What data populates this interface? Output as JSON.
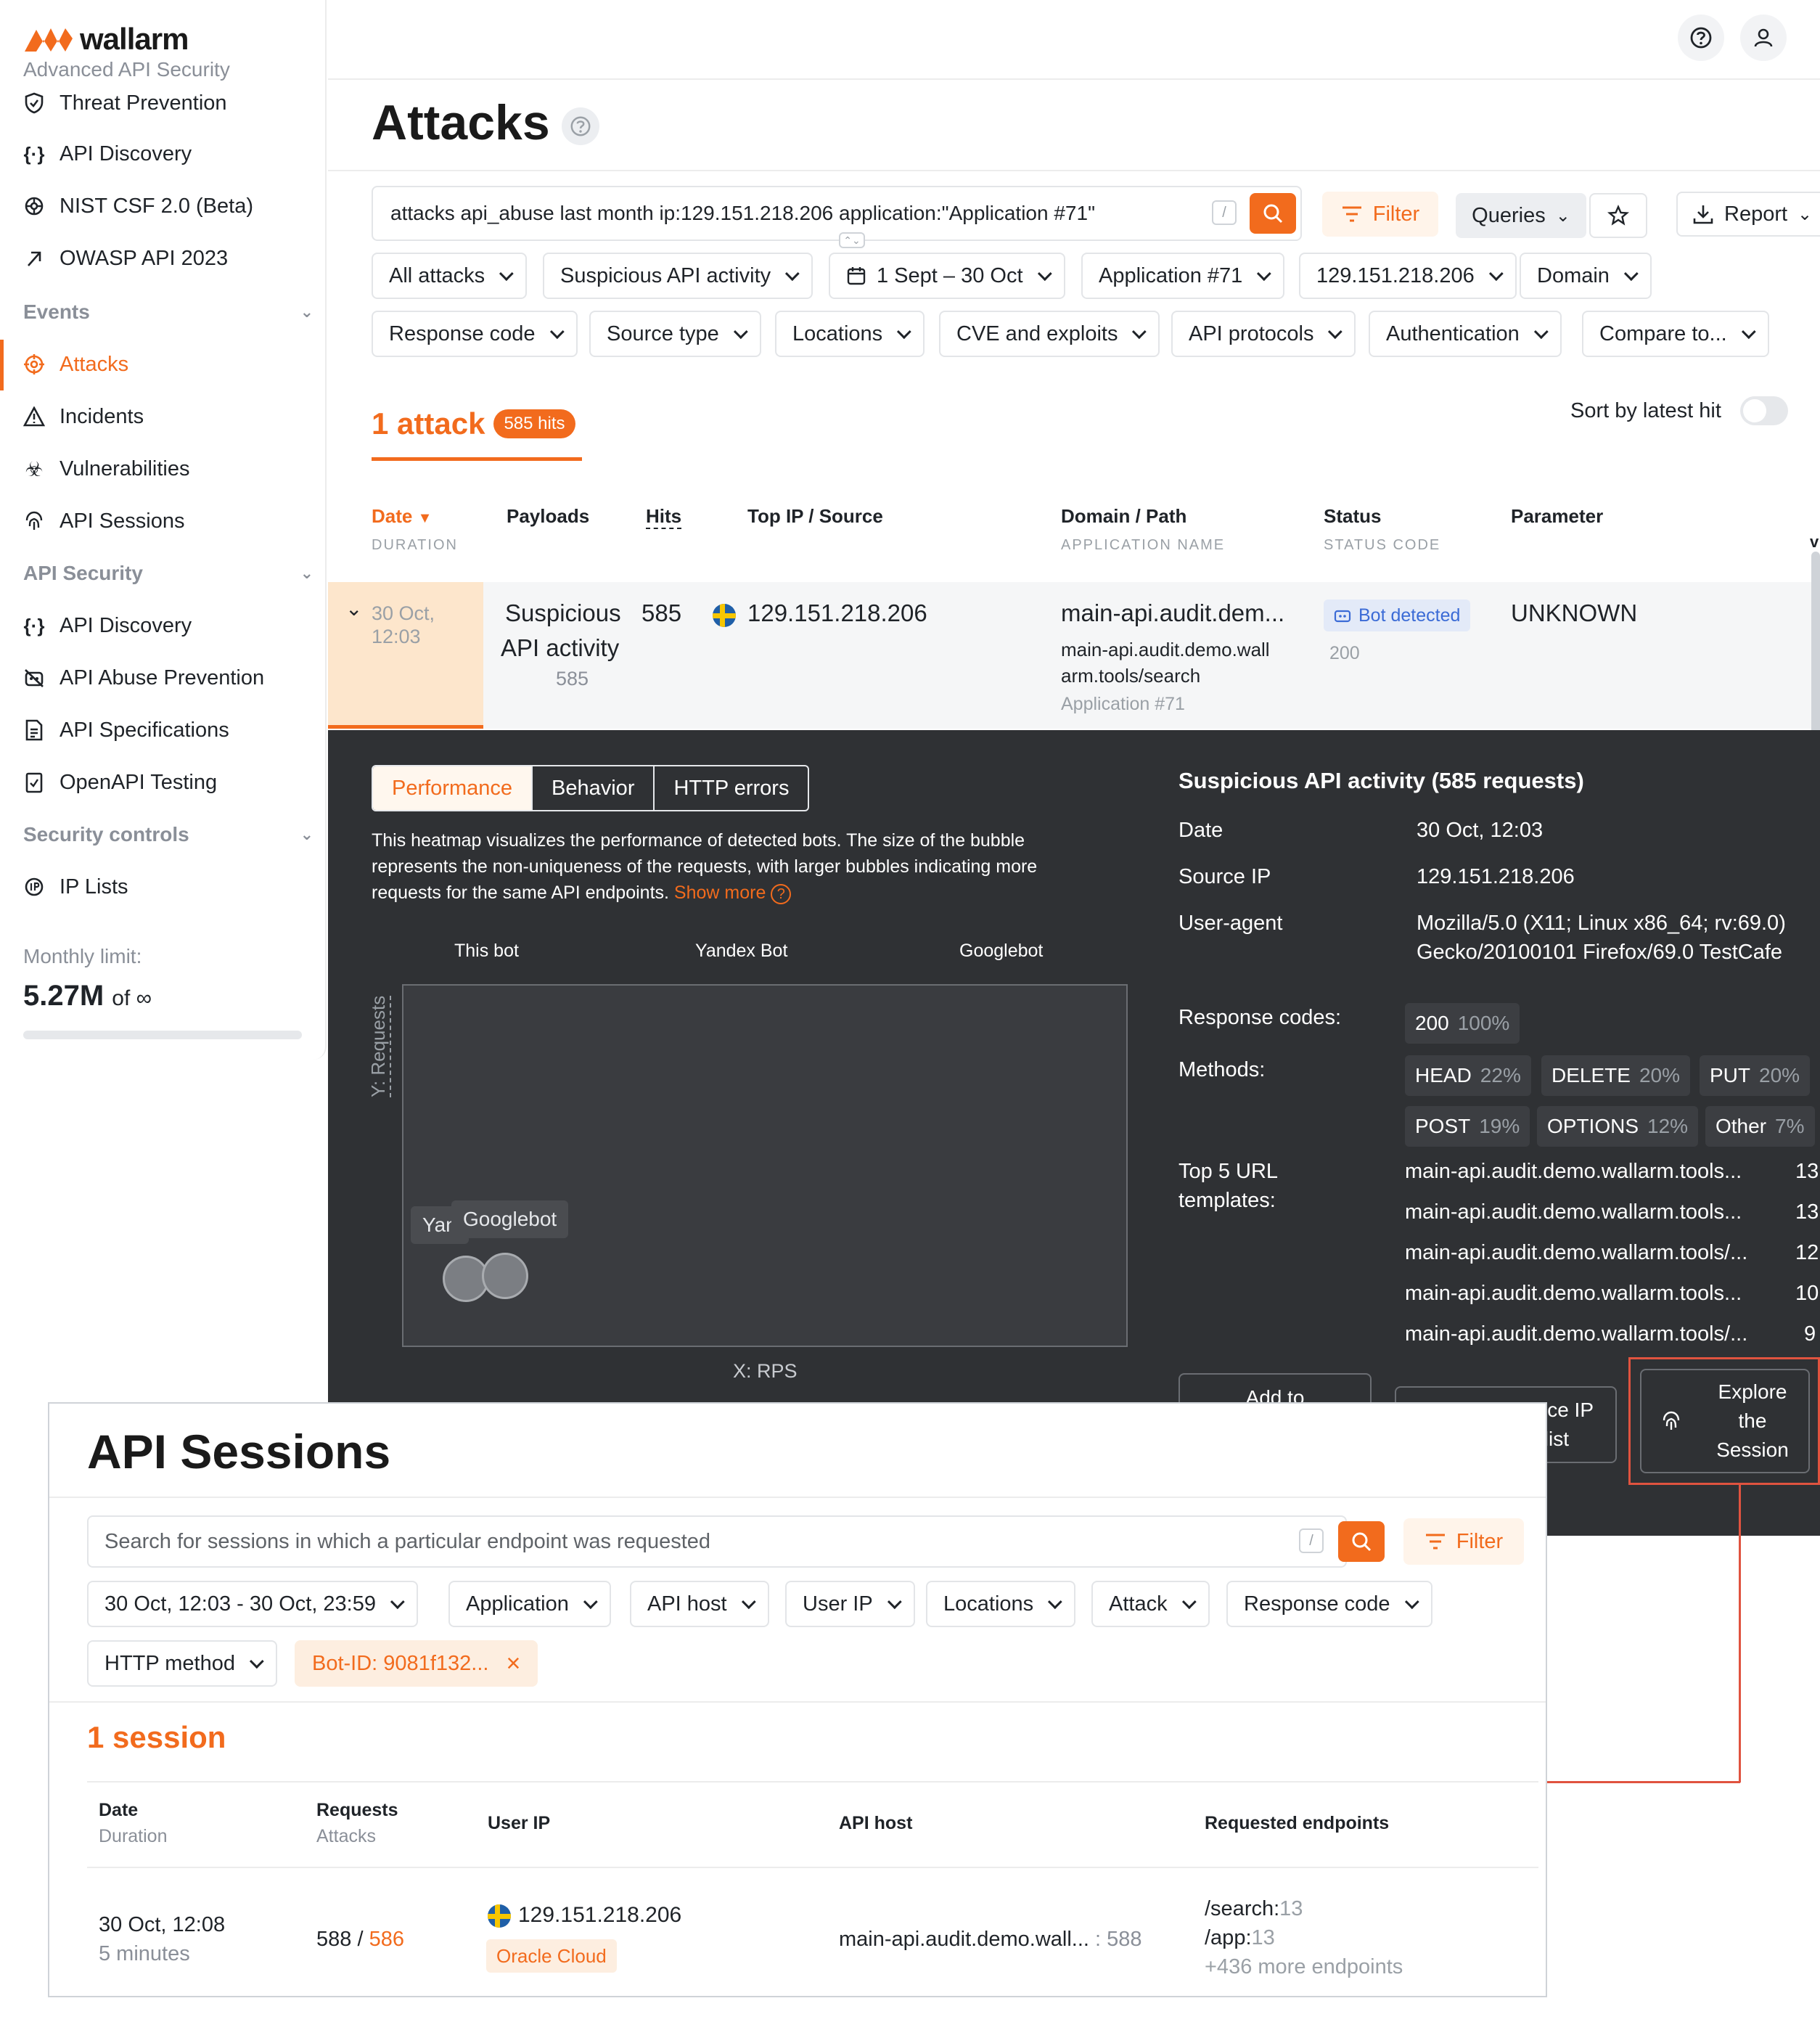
{
  "brand": {
    "name": "wallarm",
    "tagline": "Advanced API Security"
  },
  "sidebar": {
    "top_items": [
      {
        "label": "Threat Prevention",
        "icon": "shield-icon"
      },
      {
        "label": "API Discovery",
        "icon": "curly-braces-icon"
      },
      {
        "label": "NIST CSF 2.0 (Beta)",
        "icon": "gear-icon"
      },
      {
        "label": "OWASP API 2023",
        "icon": "arrow-icon"
      }
    ],
    "events": {
      "label": "Events",
      "items": [
        {
          "label": "Attacks",
          "icon": "target-icon",
          "active": true
        },
        {
          "label": "Incidents",
          "icon": "warning-icon"
        },
        {
          "label": "Vulnerabilities",
          "icon": "biohazard-icon"
        },
        {
          "label": "API Sessions",
          "icon": "fingerprint-icon"
        }
      ]
    },
    "api_security": {
      "label": "API Security",
      "items": [
        {
          "label": "API Discovery",
          "icon": "curly-braces-icon"
        },
        {
          "label": "API Abuse Prevention",
          "icon": "bot-icon"
        },
        {
          "label": "API Specifications",
          "icon": "document-icon"
        },
        {
          "label": "OpenAPI Testing",
          "icon": "checklist-icon"
        }
      ]
    },
    "security_controls": {
      "label": "Security controls",
      "items": [
        {
          "label": "IP Lists",
          "icon": "ip-icon"
        }
      ]
    },
    "limit_label": "Monthly limit:",
    "limit_value": "5.27M",
    "limit_of": "of ∞"
  },
  "attacks": {
    "title": "Attacks",
    "query": "attacks api_abuse last month ip:129.151.218.206 application:\"Application #71\"",
    "filter_label": "Filter",
    "queries_label": "Queries",
    "report_label": "Report",
    "filters_row1": [
      "All attacks",
      "Suspicious API activity",
      "1 Sept – 30 Oct",
      "Application #71",
      "129.151.218.206",
      "Domain"
    ],
    "filters_row2": [
      "Response code",
      "Source type",
      "Locations",
      "CVE and exploits",
      "API protocols",
      "Authentication",
      "Compare to..."
    ],
    "count_label": "1 attack",
    "hits_badge": "585 hits",
    "sort_label": "Sort by latest hit",
    "columns": {
      "date": "Date",
      "duration": "DURATION",
      "payloads": "Payloads",
      "hits": "Hits",
      "top_ip": "Top IP / Source",
      "domain": "Domain / Path",
      "app_name": "APPLICATION NAME",
      "status": "Status",
      "status_code": "STATUS CODE",
      "parameter": "Parameter",
      "partial": "v"
    },
    "row": {
      "date": "30 Oct,",
      "time": "12:03",
      "payload_l1": "Suspicious",
      "payload_l2": "API activity",
      "payload_sub": "585",
      "hits": "585",
      "ip": "129.151.218.206",
      "domain": "main-api.audit.dem...",
      "path_l1": "main-api.audit.demo.wall",
      "path_l2": "arm.tools/search",
      "app": "Application #71",
      "status": "Bot detected",
      "code": "200",
      "parameter": "UNKNOWN"
    }
  },
  "details": {
    "tabs": [
      "Performance",
      "Behavior",
      "HTTP errors"
    ],
    "desc_l1": "This heatmap visualizes the performance of detected bots. The size of the bubble",
    "desc_l2": "represents the non-uniqueness of the requests, with larger bubbles indicating more",
    "desc_l3": "requests for the same API endpoints.",
    "show_more": "Show more",
    "legend": [
      "This bot",
      "Yandex Bot",
      "Googlebot"
    ],
    "y_axis": "Y: Requests",
    "x_axis": "X: RPS",
    "tooltip_back": "Yan",
    "tooltip_front": "Googlebot",
    "panel_title": "Suspicious API activity (585 requests)",
    "date_label": "Date",
    "date_value": "30 Oct, 12:03",
    "ip_label": "Source IP",
    "ip_value": "129.151.218.206",
    "ua_label": "User-agent",
    "ua_l1": "Mozilla/5.0 (X11; Linux x86_64; rv:69.0)",
    "ua_l2": "Gecko/20100101 Firefox/69.0 TestCafe",
    "codes_label": "Response codes:",
    "codes": [
      {
        "name": "200",
        "pct": "100%"
      }
    ],
    "methods_label": "Methods:",
    "methods": [
      {
        "name": "HEAD",
        "pct": "22%"
      },
      {
        "name": "DELETE",
        "pct": "20%"
      },
      {
        "name": "PUT",
        "pct": "20%"
      },
      {
        "name": "POST",
        "pct": "19%"
      },
      {
        "name": "OPTIONS",
        "pct": "12%"
      },
      {
        "name": "Other",
        "pct": "7%"
      }
    ],
    "urls_label_l1": "Top 5 URL",
    "urls_label_l2": "templates:",
    "urls": [
      {
        "u": "main-api.audit.demo.wallarm.tools...",
        "n": "13"
      },
      {
        "u": "main-api.audit.demo.wallarm.tools...",
        "n": "13"
      },
      {
        "u": "main-api.audit.demo.wallarm.tools/...",
        "n": "12"
      },
      {
        "u": "main-api.audit.demo.wallarm.tools...",
        "n": "10"
      },
      {
        "u": "main-api.audit.demo.wallarm.tools/...",
        "n": "9"
      }
    ],
    "add_to": "Add to",
    "iplist_l1": "ce IP",
    "iplist_l2": "list",
    "explore_l1": "Explore",
    "explore_l2": "the",
    "explore_l3": "Session"
  },
  "sessions": {
    "title": "API Sessions",
    "search_placeholder": "Search for sessions in which a particular endpoint was requested",
    "filter_label": "Filter",
    "filters_row1": [
      "30 Oct, 12:03 - 30 Oct, 23:59",
      "Application",
      "API host",
      "User IP",
      "Locations",
      "Attack",
      "Response code"
    ],
    "method_filter": "HTTP method",
    "bot_filter": "Bot-ID: 9081f132...",
    "count_label": "1 session",
    "columns": {
      "date": "Date",
      "duration": "Duration",
      "requests": "Requests",
      "attacks": "Attacks",
      "user_ip": "User IP",
      "api_host": "API host",
      "endpoints": "Requested endpoints"
    },
    "row": {
      "date": "30 Oct, 12:08",
      "duration": "5 minutes",
      "requests": "588",
      "sep": "/",
      "attacks": "586",
      "ip": "129.151.218.206",
      "provider": "Oracle Cloud",
      "host": "main-api.audit.demo.wall...",
      "port": ": 588",
      "ep1": "/search:",
      "ep1n": "13",
      "ep2": "/app:",
      "ep2n": "13",
      "more": "+436 more endpoints"
    }
  },
  "colors": {
    "accent": "#f26b1d",
    "dark_panel": "#2f3134",
    "highlight": "#e0533f"
  }
}
